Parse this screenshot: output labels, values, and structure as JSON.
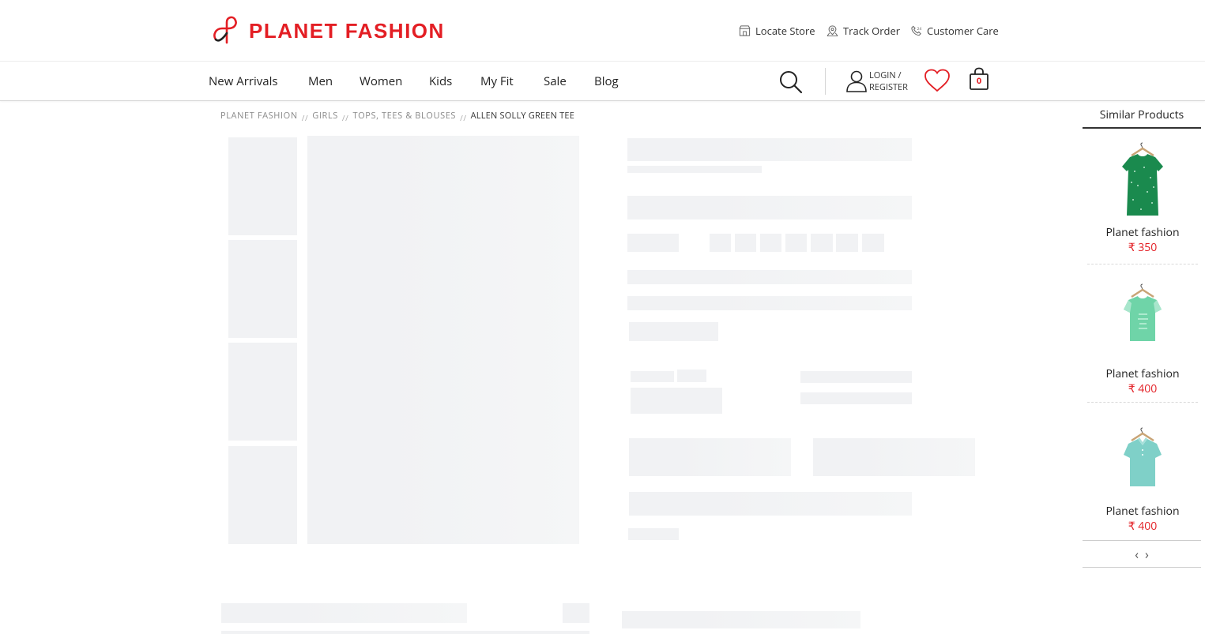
{
  "brand": {
    "name": "PLANET FASHION",
    "color": "#e31e24"
  },
  "utility_links": [
    {
      "label": "Locate Store",
      "icon": "store-icon"
    },
    {
      "label": "Track Order",
      "icon": "location-pin-icon"
    },
    {
      "label": "Customer Care",
      "icon": "phone-24-icon"
    }
  ],
  "nav": [
    "New Arrivals",
    "Men",
    "Women",
    "Kids",
    "My Fit",
    "Sale",
    "Blog"
  ],
  "account": {
    "login_line1": "LOGIN /",
    "login_line2": "REGISTER",
    "cart_count": "0"
  },
  "breadcrumb": [
    "PLANET FASHION",
    "GIRLS",
    "TOPS, TEES & BLOUSES",
    "ALLEN SOLLY GREEN TEE"
  ],
  "breadcrumb_separator": "//",
  "similar": {
    "title": "Similar Products",
    "items": [
      {
        "name": "Planet fashion",
        "price": "₹ 350",
        "color": "#1a8a4e",
        "icon": "green-printed-top-image"
      },
      {
        "name": "Planet fashion",
        "price": "₹ 400",
        "color": "#6fd4a8",
        "icon": "mint-graphic-tee-image"
      },
      {
        "name": "Planet fashion",
        "price": "₹ 400",
        "color": "#7fd0c8",
        "icon": "aqua-polo-tee-image"
      }
    ],
    "prev_label": "‹",
    "next_label": "›"
  }
}
